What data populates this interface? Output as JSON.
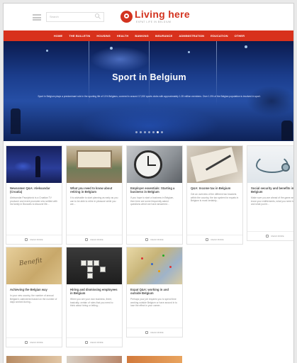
{
  "header": {
    "search_placeholder": "Search",
    "logo_text": "Living here",
    "logo_tagline": "EXPAT LIFE IN BELGIUM"
  },
  "nav": {
    "items": [
      "HOME",
      "THE BULLETIN",
      "HOUSING",
      "HEALTH",
      "BANKING",
      "INSURANCE",
      "ADMINISTRATION",
      "EDUCATION",
      "OTHER"
    ]
  },
  "hero": {
    "title": "Sport in Belgium",
    "description": "Sport in Belgium plays a predominant role in the sporting life of 11% Belgians, covered in around 17,000 sports clubs with approximately 1.25 million members. Over 1.5% of the Belgian population is involved in sport.",
    "dots": 7,
    "active_dot": 5
  },
  "cards": [
    {
      "title": "Newcomer Q&A: Aleksandar (Croatia)",
      "desc": "Aleksandar Paunjelovic is a Croatian TV producer and event promoter who settled with his family in Brussels to discover life...",
      "footer": "READ MORE"
    },
    {
      "title": "What you need to know about retiring in Belgium",
      "desc": "It is advisable to start planning as early as you can to be able to retire in pleasure while you are...",
      "footer": "READ MORE"
    },
    {
      "title": "Employer essentials: Starting a business in Belgium",
      "desc": "If you hope to start a business in Belgium, then here are some frequently asked questions which we have answered...",
      "footer": "READ MORE"
    },
    {
      "title": "Q&A: Income tax in Belgium",
      "desc": "Get an overview of the different tax brackets within the country, the tax system for expats in Belgium is most certainly...",
      "footer": "READ MORE"
    },
    {
      "title": "Social security and benefits in Belgium",
      "desc": "Make sure you are ahead of the game and know your entitlements, what you need to pay and what you're...",
      "footer": "READ MORE"
    },
    {
      "title": "Achieving the Belgian way",
      "desc": "In your new country, the number of annual Belgian's calendered based on the number of days worked during...",
      "footer": "READ MORE"
    },
    {
      "title": "Hiring and dismissing employees in Belgium",
      "desc": "When you are your own business, there, basically, certain of rules that you need to think about hiring or letting...",
      "footer": "READ MORE"
    },
    {
      "title": "Expat Q&A: working in and outside Belgium",
      "desc": "Perhaps your job requires you to spend time working outside Belgium or have around in to lose the effect in your career...",
      "footer": "READ MORE"
    }
  ]
}
